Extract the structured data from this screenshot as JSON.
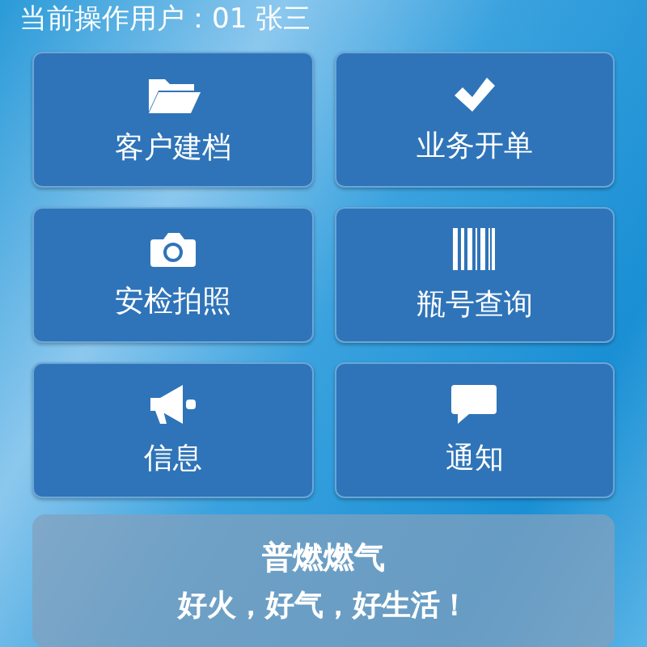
{
  "header": {
    "user_label": "当前操作用户：01 张三"
  },
  "tiles": [
    {
      "label": "客户建档"
    },
    {
      "label": "业务开单"
    },
    {
      "label": "安检拍照"
    },
    {
      "label": "瓶号查询"
    },
    {
      "label": "信息"
    },
    {
      "label": "通知"
    }
  ],
  "banner": {
    "title": "普燃燃气",
    "slogan": "好火，好气，好生活！"
  }
}
